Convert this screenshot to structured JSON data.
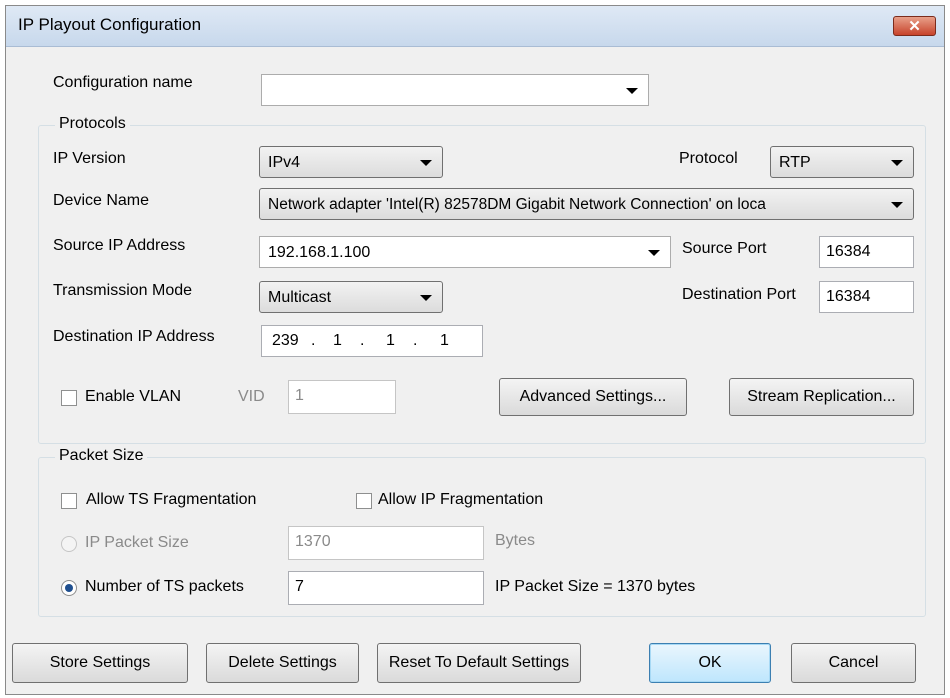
{
  "window": {
    "title": "IP Playout Configuration",
    "close_glyph": "✕"
  },
  "config_name": {
    "label": "Configuration name",
    "value": ""
  },
  "protocols": {
    "legend": "Protocols",
    "ip_version_label": "IP Version",
    "ip_version_value": "IPv4",
    "protocol_label": "Protocol",
    "protocol_value": "RTP",
    "device_name_label": "Device Name",
    "device_name_value": "Network adapter 'Intel(R) 82578DM Gigabit Network Connection' on loca",
    "source_ip_label": "Source IP Address",
    "source_ip_value": "192.168.1.100",
    "source_port_label": "Source Port",
    "source_port_value": "16384",
    "transmission_mode_label": "Transmission Mode",
    "transmission_mode_value": "Multicast",
    "dest_port_label": "Destination Port",
    "dest_port_value": "16384",
    "dest_ip_label": "Destination IP Address",
    "dest_ip_parts": [
      "239",
      "1",
      "1",
      "1"
    ],
    "dest_ip_sep": ".",
    "enable_vlan_label": "Enable VLAN",
    "vid_label": "VID",
    "vid_value": "1",
    "advanced_button": "Advanced Settings...",
    "replication_button": "Stream Replication..."
  },
  "packet_size": {
    "legend": "Packet Size",
    "allow_ts_frag_label": "Allow TS Fragmentation",
    "allow_ip_frag_label": "Allow IP Fragmentation",
    "ip_packet_size_label": "IP Packet Size",
    "ip_packet_size_value": "1370",
    "bytes_label": "Bytes",
    "num_ts_packets_label": "Number of TS packets",
    "num_ts_packets_value": "7",
    "computed_text": "IP Packet Size =  1370 bytes"
  },
  "footer": {
    "store": "Store Settings",
    "delete": "Delete Settings",
    "reset": "Reset To Default Settings",
    "ok": "OK",
    "cancel": "Cancel"
  }
}
